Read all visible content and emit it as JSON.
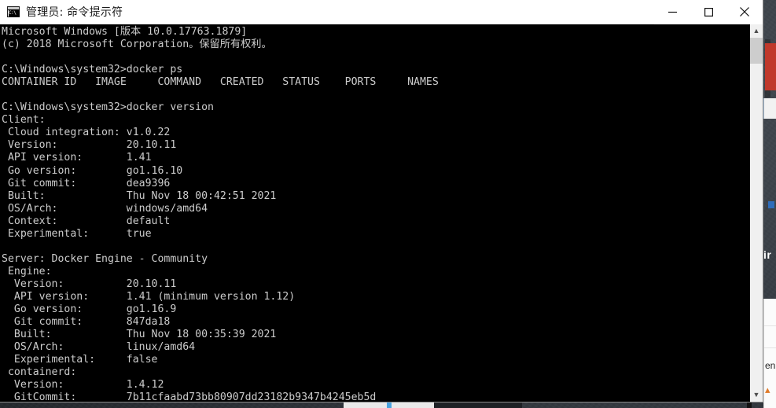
{
  "window": {
    "title": "管理员: 命令提示符",
    "icon": "cmd-icon",
    "controls": {
      "minimize": "minimize-icon",
      "maximize": "maximize-icon",
      "close": "close-icon"
    }
  },
  "scrollbar": {
    "up_arrow": "▲",
    "down_arrow": "▼"
  },
  "console": {
    "foreground_color": "#cccccc",
    "background_color": "#000000",
    "lines": [
      "Microsoft Windows [版本 10.0.17763.1879]",
      "(c) 2018 Microsoft Corporation。保留所有权利。",
      "",
      "C:\\Windows\\system32>docker ps",
      "CONTAINER ID   IMAGE     COMMAND   CREATED   STATUS    PORTS     NAMES",
      "",
      "C:\\Windows\\system32>docker version",
      "Client:",
      " Cloud integration: v1.0.22",
      " Version:           20.10.11",
      " API version:       1.41",
      " Go version:        go1.16.10",
      " Git commit:        dea9396",
      " Built:             Thu Nov 18 00:42:51 2021",
      " OS/Arch:           windows/amd64",
      " Context:           default",
      " Experimental:      true",
      "",
      "Server: Docker Engine - Community",
      " Engine:",
      "  Version:          20.10.11",
      "  API version:      1.41 (minimum version 1.12)",
      "  Go version:       go1.16.9",
      "  Git commit:       847da18",
      "  Built:            Thu Nov 18 00:35:39 2021",
      "  OS/Arch:          linux/amd64",
      "  Experimental:     false",
      " containerd:",
      "  Version:          1.4.12",
      "  GitCommit:        7b11cfaabd73bb80907dd23182b9347b4245eb5d"
    ]
  },
  "desktop": {
    "peek_text": "ir"
  }
}
